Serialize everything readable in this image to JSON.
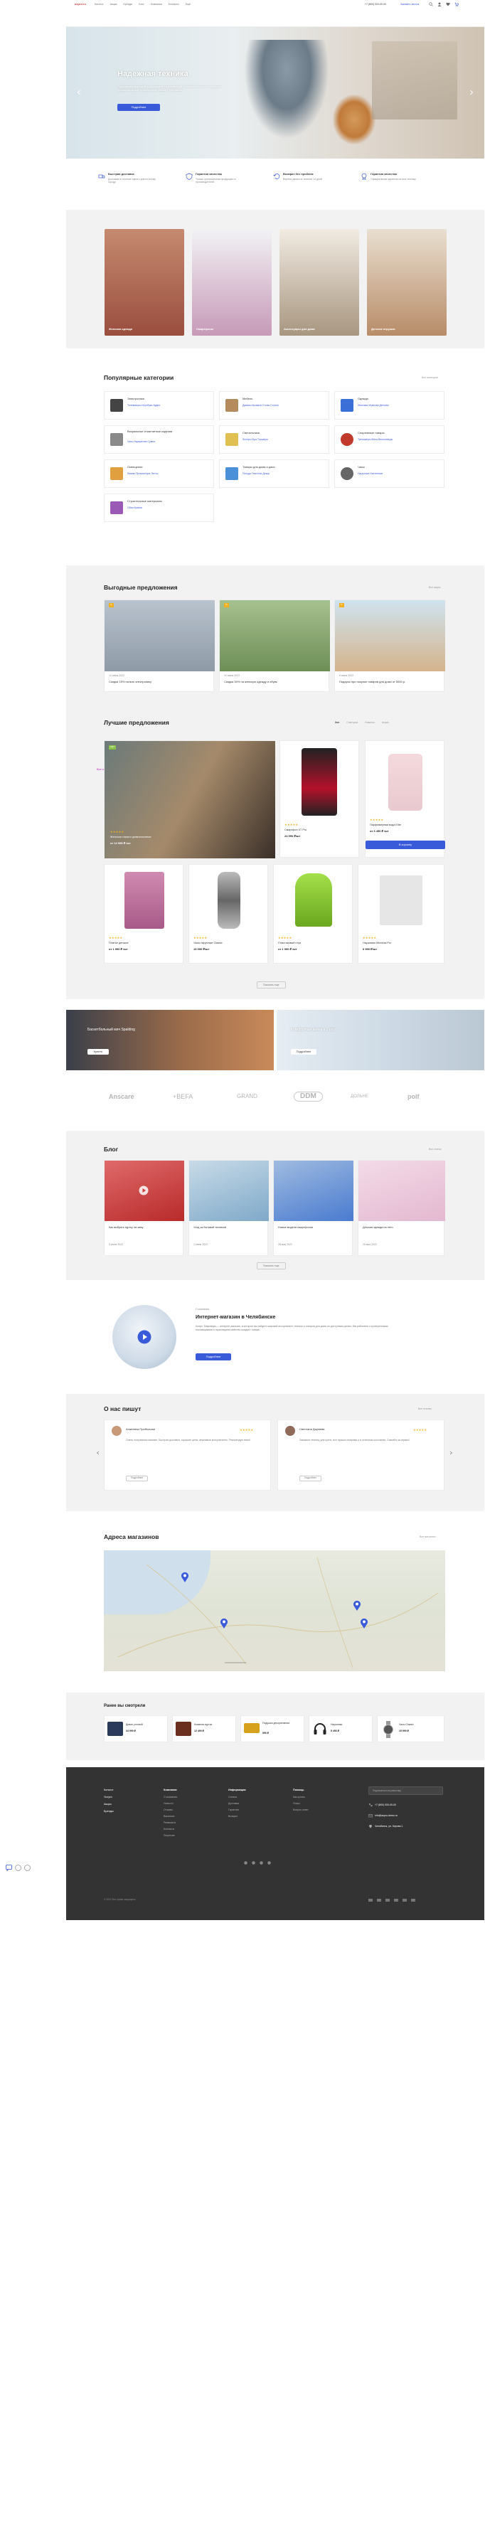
{
  "header": {
    "logo": "aspro.ru",
    "nav": [
      "Каталог",
      "Акции",
      "Бренды",
      "Блог",
      "Компания",
      "Контакты",
      "Ещё"
    ],
    "phone": "+7 (800) 000-00-00",
    "callback": "Заказать звонок"
  },
  "hero": {
    "title": "Надежная техника",
    "text": "Предлагаем широкий ассортимент качественной бытовой техники от ведущих производителей по выгодным ценам с доставкой",
    "button": "Подробнее"
  },
  "advantages": [
    {
      "title": "Быстрая доставка",
      "text": "Доставим в течение одного дня по всему городу"
    },
    {
      "title": "Гарантия качества",
      "text": "Только оригинальная продукция от производителей"
    },
    {
      "title": "Возврат без проблем",
      "text": "Вернем деньги в течение 14 дней"
    },
    {
      "title": "Гарантия качества",
      "text": "Официальная гарантия на всю технику"
    }
  ],
  "promo_tiles": [
    {
      "label": "Женская одежда",
      "color": "#b36a4d"
    },
    {
      "label": "Смартфоны",
      "color": "#c79ab8"
    },
    {
      "label": "Аксессуары для дома",
      "color": "#c7b6a2"
    },
    {
      "label": "Детские игрушки",
      "color": "#b88c68"
    }
  ],
  "categories": {
    "title": "Популярные категории",
    "all": "Все категории",
    "items": [
      {
        "name": "Электроника",
        "subs": "Телевизоры  Ноутбуки  Аудио",
        "color": "#444"
      },
      {
        "name": "Мебель",
        "subs": "Диваны  Кровати  Столы  Стулья",
        "color": "#b38b5d"
      },
      {
        "name": "Одежда",
        "subs": "Женская  Мужская  Детская",
        "color": "#3a6fd8"
      },
      {
        "name": "Визуальные и магнитные изделия",
        "subs": "Часы  Украшения  Сумки",
        "color": "#8a8a8a"
      },
      {
        "name": "Светильники",
        "subs": "Люстры  Бра  Торшеры",
        "color": "#e0c050"
      },
      {
        "name": "Спортивные товары",
        "subs": "Тренажеры  Мячи  Велосипеды",
        "color": "#c0392b"
      },
      {
        "name": "Освещение",
        "subs": "Лампы  Прожекторы  Ленты",
        "color": "#e0a040"
      },
      {
        "name": "Товары для дома и дачи",
        "subs": "Посуда  Текстиль  Декор",
        "color": "#4a90d9"
      },
      {
        "name": "Часы",
        "subs": "Наручные  Настенные",
        "color": "#666"
      },
      {
        "name": "Строительные материалы",
        "subs": "Обои  Краски",
        "color": "#9b59b6"
      }
    ]
  },
  "offers": {
    "title": "Выгодные предложения",
    "all": "Все акции",
    "items": [
      {
        "date": "12 июня 2022",
        "text": "Скидка 15% на всю электронику",
        "color": "#9aa7b5"
      },
      {
        "date": "10 июня 2022",
        "text": "Скидка 30% на женскую одежду и обувь",
        "color": "#8fae7a"
      },
      {
        "date": "8 июня 2022",
        "text": "Подарок при покупке товаров для дома от 5000 р.",
        "color": "#d4b48c"
      }
    ]
  },
  "best": {
    "title": "Лучшие предложения",
    "tabs": [
      "Хит",
      "Советуем",
      "Новинка",
      "Акция"
    ],
    "side_label": "Все предложения",
    "featured": {
      "name": "Женское пальто демисезонное",
      "price": "от 12 990 ₽ /шт",
      "button": "В корзину"
    },
    "products": [
      {
        "name": "Смартфон X7 Pro",
        "price": "24 990 ₽/шт",
        "color": "#b3112a"
      },
      {
        "name": "Парфюмерная вода Elite",
        "price": "от 3 490 ₽ /шт",
        "color": "#e8c9cf"
      },
      {
        "name": "Платье детское",
        "price": "от 1 990 ₽ /шт",
        "color": "#c07aa3"
      },
      {
        "name": "Часы наручные Classic",
        "price": "15 990 ₽/шт",
        "color": "#888"
      },
      {
        "name": "Пластиковый стул",
        "price": "от 1 990 ₽ /шт",
        "color": "#8bd02e"
      },
      {
        "name": "Наушники Wireless Pro",
        "price": "6 990 ₽/шт",
        "color": "#c7c7c7"
      }
    ],
    "more": "Показать еще"
  },
  "banners": [
    {
      "title": "Баскетбольный мяч Spalding",
      "button": "Купить"
    },
    {
      "title": "Комфортная ванна в 2 раза",
      "button": "Подробнее"
    }
  ],
  "brands": [
    "Anscare",
    "+BEFA",
    "GRAND",
    "DDM",
    "ДОЛЬНЕ",
    "polf"
  ],
  "blog": {
    "title": "Блог",
    "all": "Все статьи",
    "items": [
      {
        "text": "Как выбрать куртку на зиму",
        "date": "5 июня 2022",
        "color": "#d13a3a"
      },
      {
        "text": "Уход за бытовой техникой",
        "date": "2 июня 2022",
        "color": "#7fa9c9"
      },
      {
        "text": "Новые модели смартфонов",
        "date": "28 мая 2022",
        "color": "#4a7bd0"
      },
      {
        "text": "Детская одежда на лето",
        "date": "25 мая 2022",
        "color": "#e4b8d0"
      }
    ],
    "more": "Показать еще"
  },
  "about": {
    "caption": "О компании",
    "title": "Интернет-магазин в Челябинске",
    "text": "Аспро: Максимум — интернет-магазин, в котором вы найдете широкий ассортимент техники и товаров для дома по доступным ценам. Мы работаем с проверенными поставщиками и гарантируем качество каждого товара.",
    "button": "Подробнее"
  },
  "reviews": {
    "title": "О нас пишут",
    "all": "Все отзывы",
    "items": [
      {
        "name": "Анжелика Прибылова",
        "text": "Очень понравился магазин. Быстрая доставка, хорошие цены, вежливые консультанты. Рекомендую всем!",
        "link": "Подробнее"
      },
      {
        "name": "Светлана Дыряева",
        "text": "Заказала технику для кухни, все пришло вовремя и в отличном состоянии. Спасибо за сервис!",
        "link": "Подробнее"
      }
    ]
  },
  "stores": {
    "title": "Адреса магазинов",
    "all": "Все магазины"
  },
  "viewed": {
    "title": "Ранее вы смотрели",
    "items": [
      {
        "name": "Диван угловой",
        "price": "34 990 ₽",
        "color": "#2a3a5a"
      },
      {
        "name": "Кожаная куртка",
        "price": "12 490 ₽",
        "color": "#6b2f1f"
      },
      {
        "name": "Подушка декоративная",
        "price": "990 ₽",
        "color": "#d6a21e"
      },
      {
        "name": "Наушники",
        "price": "5 490 ₽",
        "color": "#222"
      },
      {
        "name": "Часы Classic",
        "price": "15 990 ₽",
        "color": "#777"
      }
    ]
  },
  "footer": {
    "logo_col": [
      "Каталог",
      "Услуги",
      "Акции",
      "Бренды"
    ],
    "col1_title": "Компания",
    "col1": [
      "О компании",
      "Новости",
      "Отзывы",
      "Вакансии",
      "Реквизиты",
      "Контакты",
      "Лицензии"
    ],
    "col2_title": "Информация",
    "col2": [
      "Оплата",
      "Доставка",
      "Гарантия",
      "Возврат"
    ],
    "col3_title": "Помощь",
    "col3": [
      "Как купить",
      "Поиск",
      "Вопрос-ответ"
    ],
    "subscribe": "Подписаться на рассылку",
    "phone": "+7 (800) 000-00-00",
    "email": "info@aspro-demo.ru",
    "address": "Челябинск, ул. Кирова 1",
    "copyright": "© 2022 Все права защищены"
  }
}
